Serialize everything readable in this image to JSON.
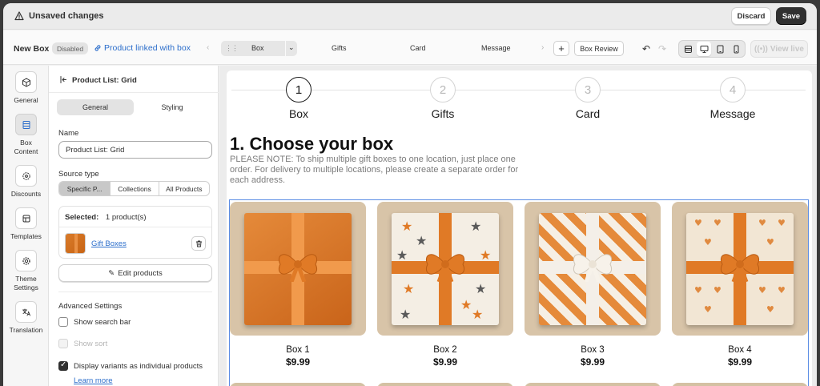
{
  "unsaved": {
    "title": "Unsaved changes",
    "discard": "Discard",
    "save": "Save"
  },
  "toolbar": {
    "name": "New Box",
    "status": "Disabled",
    "link": "Product linked with box",
    "current_step": "Box",
    "steps": [
      "Gifts",
      "Card",
      "Message"
    ],
    "add": "+",
    "review": "Box Review",
    "view_live": "View live"
  },
  "rail": {
    "items": [
      {
        "label": "General",
        "icon": "cube-icon"
      },
      {
        "label": "Box\nContent",
        "icon": "list-icon"
      },
      {
        "label": "Discounts",
        "icon": "discount-icon"
      },
      {
        "label": "Templates",
        "icon": "template-icon"
      },
      {
        "label": "Theme\nSettings",
        "icon": "gear-icon"
      },
      {
        "label": "Translation",
        "icon": "translate-icon"
      }
    ]
  },
  "panel": {
    "title": "Product List: Grid",
    "tabs": [
      "General",
      "Styling"
    ],
    "name_label": "Name",
    "name_value": "Product List: Grid",
    "source_label": "Source type",
    "source_options": [
      "Specific P...",
      "Collections",
      "All Products"
    ],
    "selected_label": "Selected:",
    "selected_value": "1 product(s)",
    "product_name": "Gift Boxes",
    "edit_products": "Edit products",
    "advanced": "Advanced Settings",
    "opt_search": "Show search bar",
    "opt_sort": "Show sort",
    "opt_variants": "Display variants as individual products",
    "learn_more": "Learn more"
  },
  "preview": {
    "steps": [
      {
        "num": "1",
        "name": "Box"
      },
      {
        "num": "2",
        "name": "Gifts"
      },
      {
        "num": "3",
        "name": "Card"
      },
      {
        "num": "4",
        "name": "Message"
      }
    ],
    "heading": "1. Choose your box",
    "note": "PLEASE NOTE: To ship multiple gift boxes to one location, just place one order. For delivery to multiple locations, please create a separate order for each address.",
    "products": [
      {
        "name": "Box 1",
        "price": "$9.99"
      },
      {
        "name": "Box 2",
        "price": "$9.99"
      },
      {
        "name": "Box 3",
        "price": "$9.99"
      },
      {
        "name": "Box 4",
        "price": "$9.99"
      }
    ]
  },
  "colors": {
    "accent": "#2c6ecb",
    "primary": "#303030",
    "orange": "#d9742a",
    "selection": "#5b8de5"
  }
}
